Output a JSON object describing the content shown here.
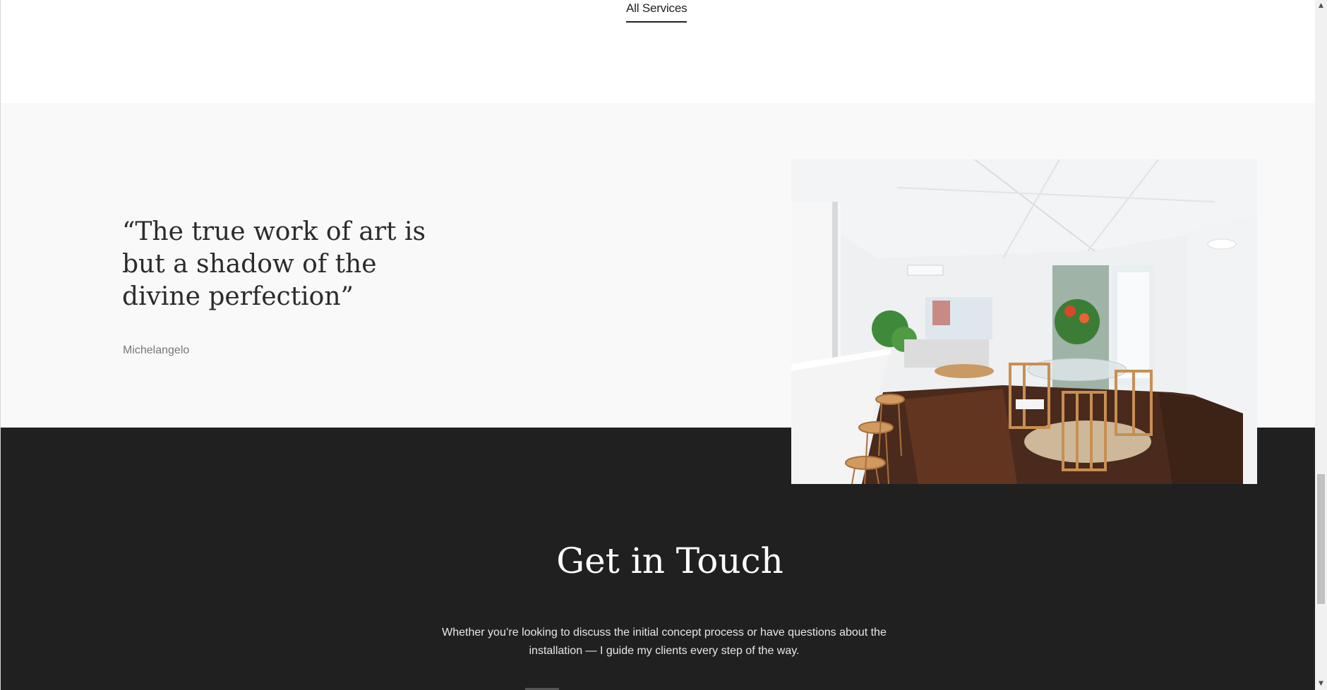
{
  "nav": {
    "all_services_label": "All Services"
  },
  "quote": {
    "text": "“The true work of art is but a shadow of the divine perfection”",
    "author": "Michelangelo"
  },
  "photo": {
    "subject": "bright white interior with kitchen bar stools, dining table with rattan chairs and flowers, living area"
  },
  "contact": {
    "title": "Get in Touch",
    "text": "Whether you’re looking to discuss the initial concept process or have questions about the installation — I guide my clients every step of the way."
  },
  "scrollbar": {
    "up_icon": "▲",
    "down_icon": "▼"
  },
  "colors": {
    "dark_band": "#202020",
    "quote_band": "#f9f9f9",
    "text_dark": "#2b2b2b"
  }
}
